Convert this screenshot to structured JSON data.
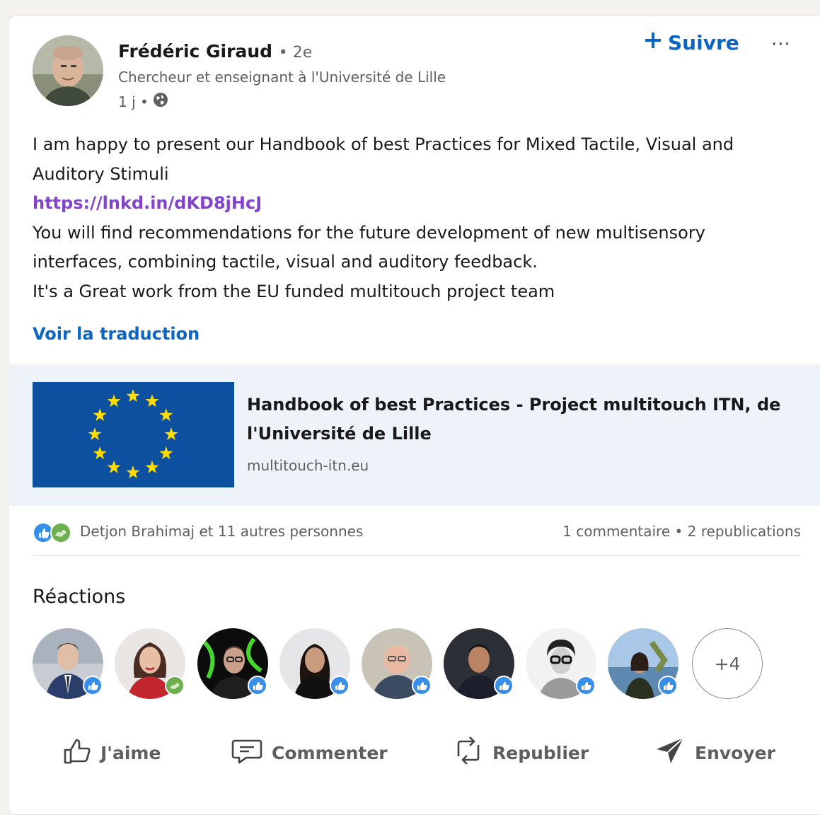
{
  "post": {
    "author": {
      "name": "Frédéric Giraud",
      "degree": "• 2e",
      "headline": "Chercheur et enseignant à l'Université de Lille",
      "time": "1 j •",
      "visibility_icon": "globe-icon"
    },
    "follow_label": "Suivre",
    "more_label": "···",
    "text_lines": [
      "I am happy to present our Handbook of best Practices for Mixed Tactile, Visual and Auditory Stimuli",
      "https://lnkd.in/dKD8jHcJ",
      "You will find recommendations for the future development of new multisensory interfaces, combining tactile, visual and auditory feedback.",
      "It's a Great work from the EU funded multitouch project team"
    ],
    "translate_label": "Voir la traduction",
    "link_preview": {
      "title": "Handbook of best Practices - Project multitouch ITN, de l'Université de Lille",
      "domain": "multitouch-itn.eu",
      "image": "eu-flag-image"
    },
    "social": {
      "reactions_text": "Detjon Brahimaj et 11 autres personnes",
      "counts_text": "1 commentaire • 2 republications",
      "reaction_icons": [
        "like-icon",
        "support-icon"
      ]
    },
    "reactions_section": {
      "title": "Réactions",
      "more_count": "+4"
    },
    "actions": {
      "like": "J'aime",
      "comment": "Commenter",
      "repost": "Republier",
      "send": "Envoyer"
    }
  },
  "colors": {
    "accent": "#0a66c2",
    "link": "#8344cc",
    "eu_blue": "#0d50a0",
    "eu_star": "#ffdd00",
    "preview_bg": "#edf3f8"
  }
}
